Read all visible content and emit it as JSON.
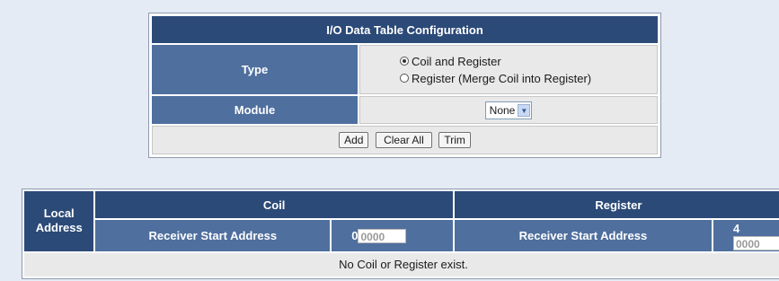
{
  "config": {
    "title": "I/O Data Table Configuration",
    "type_label": "Type",
    "type_options": [
      {
        "label": "Coil and Register",
        "selected": true
      },
      {
        "label": "Register (Merge Coil into Register)",
        "selected": false
      }
    ],
    "module_label": "Module",
    "module_value": "None",
    "buttons": {
      "add": "Add",
      "clear_all": "Clear All",
      "trim": "Trim"
    }
  },
  "io_table": {
    "local_address_line1": "Local",
    "local_address_line2": "Address",
    "coil": {
      "header": "Coil",
      "receiver_label": "Receiver Start Address",
      "prefix": "0",
      "placeholder": "0000"
    },
    "register": {
      "header": "Register",
      "receiver_label": "Receiver Start Address",
      "prefix": "4",
      "placeholder": "0000"
    },
    "empty_message": "No Coil or Register exist."
  },
  "colors": {
    "header_bg": "#2b4a78",
    "label_bg": "#4f6f9e",
    "page_bg": "#e4ebf4",
    "cell_bg": "#e9e9e9"
  }
}
